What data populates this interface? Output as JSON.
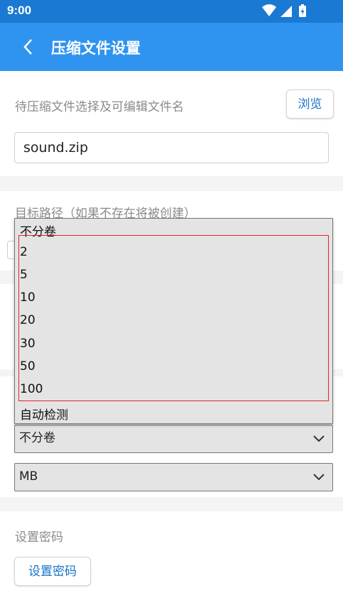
{
  "status_bar": {
    "time": "9:00"
  },
  "app_bar": {
    "title": "压缩文件设置"
  },
  "file_section": {
    "label": "待压缩文件选择及可编辑文件名",
    "browse_button": "浏览",
    "filename_value": "sound.zip"
  },
  "target_section": {
    "label": "目标路径（如果不存在将被创建）"
  },
  "dropdown": {
    "items": [
      "不分卷",
      "2",
      "5",
      "10",
      "20",
      "30",
      "50",
      "100",
      "自动检测"
    ]
  },
  "split_select": {
    "value": "不分卷"
  },
  "unit_select": {
    "value": "MB"
  },
  "password_section": {
    "label": "设置密码",
    "button": "设置密码"
  },
  "colors": {
    "status_bar": "#1a79d2",
    "app_bar": "#2f94ef",
    "accent_text": "#1573c9",
    "highlight_box": "#e0262a"
  }
}
